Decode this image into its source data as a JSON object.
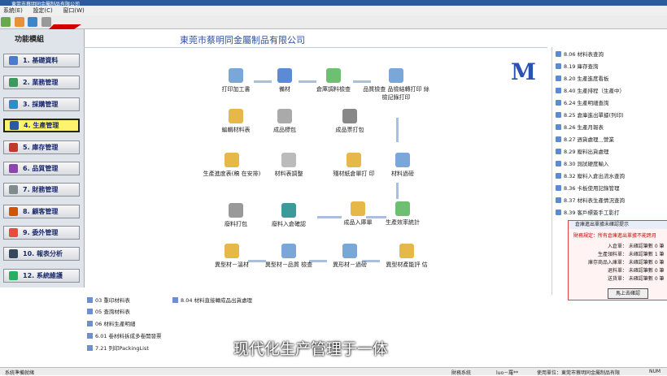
{
  "window": {
    "title": "東莞市蔡明同金屬制品有限公司"
  },
  "menu": [
    "系統(E)",
    "設定(C)",
    "窗口(W)"
  ],
  "sidebar": {
    "title": "功能模組",
    "items": [
      {
        "label": "1. 基礎資料"
      },
      {
        "label": "2. 業務管理"
      },
      {
        "label": "3. 採購管理"
      },
      {
        "label": "4. 生產管理"
      },
      {
        "label": "5. 庫存管理"
      },
      {
        "label": "6. 品質管理"
      },
      {
        "label": "7. 財務管理"
      },
      {
        "label": "8. 顧客管理"
      },
      {
        "label": "9. 委外管理"
      },
      {
        "label": "10. 報表分析"
      },
      {
        "label": "12. 系統維護"
      }
    ]
  },
  "main": {
    "company": "東莞市蔡明同金屬制品有限公司",
    "logo_letter": "M",
    "nodes": {
      "print_process": "打印加工書",
      "material": "備材",
      "warehouse_check": "倉庫調料檢查",
      "quality_check": "品質檢查 品檢結轉打印 絲檢記錄打印",
      "bom": "編輯材料表",
      "product_pack": "成品標包",
      "finished_print": "成品票打包",
      "schedule": "生產進度表(稿 在安排)",
      "material_adjust": "材料表調整",
      "scrap_print": "殘材紙倉單打 印",
      "material_transfer": "材料過磅",
      "scrap_pack": "廢料打包",
      "scrap_warehouse": "廢料入倉確認",
      "warehouse_in": "成品入庫單",
      "efficiency": "生產效率統計",
      "shape_clip": "異型材－溫材",
      "shape_quality": "異型材－品質 檢查",
      "shape_transfer": "異形材－過磅",
      "shape_cost": "異型材產能評 估"
    }
  },
  "right_list": [
    "8.06 材料表查詢",
    "8.19 庫存查詢",
    "8.20 生產進度看板",
    "8.40 生產排程（生產中）",
    "6.24 生產明細查詢",
    "8.25 倉庫進出單據(列印)",
    "8.26 生產月報表",
    "8.27 週貨處理＿營業",
    "8.29 廢料出貨處理",
    "8.30 測試硬度輸入",
    "8.32 廢料入倉出流水查詢",
    "8.36 卡板使用記錄管理",
    "8.37 材料表生產情況查詢",
    "8.39 客戶標簽手工影打"
  ],
  "reminder": {
    "title": "倉庫進出單據未確認提示",
    "warning": "財務規定：所有倉庫進出單據不能跨月",
    "rows": [
      {
        "k": "入倉單：",
        "v": "未確認筆數 0 筆"
      },
      {
        "k": "生產領料單：",
        "v": "未確認筆數 1 筆"
      },
      {
        "k": "庫存商品入庫單：",
        "v": "未確認筆數 0 筆"
      },
      {
        "k": "退料單：",
        "v": "未確認筆數 0 筆"
      },
      {
        "k": "送貨單：",
        "v": "未確認筆數 0 筆"
      }
    ],
    "button": "馬上去確認"
  },
  "bottom_list": [
    "03 重印材料表",
    "05 查詢材料表",
    "06 材料生產明細",
    "6.01 卷材料拆成多卷開發票",
    "7.21 列印PackingList",
    "8.04 材料直接轉成品出貨處理"
  ],
  "subtitle": "现代化生产管理于一体",
  "status": {
    "left": "系統準備就緒",
    "mid1": "財務系統",
    "mid2": "luo－羅**",
    "user": "使用單位：東莞市蔡明同金屬制品有限",
    "num": "NUM"
  }
}
